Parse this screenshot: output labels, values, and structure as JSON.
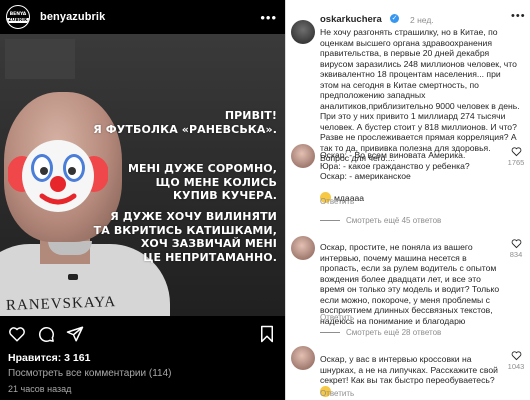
{
  "post": {
    "account": "benyazubrik",
    "avatar_text_top": "BENYA",
    "avatar_text_bottom": "ZUBRIK",
    "more_icon": "ellipsis-icon",
    "image": {
      "text_line1": "ПРИВІТ!",
      "text_line2": "Я ФУТБОЛКА «РАНЕВСЬКА».",
      "text_block2": [
        "МЕНІ ДУЖЕ СОРОМНО,",
        "ЩО МЕНЕ КОЛИСЬ",
        "КУПИВ КУЧЕРА."
      ],
      "text_block3": [
        "Я ДУЖЕ ХОЧУ ВИЛИНЯТИ",
        "ТА ВКРИТИСЬ КАТИШКАМИ,",
        "ХОЧ ЗАЗВИЧАЙ МЕНІ",
        "ЦЕ НЕПРИТАМАННО."
      ],
      "shirt_text": "RANEVSKAYA"
    },
    "actions": [
      "heart-icon",
      "comment-icon",
      "share-icon",
      "save-icon"
    ],
    "likes": "Нравится: 3 161",
    "view_all_comments": "Посмотреть все комментарии (114)",
    "time_ago": "21 часов назад"
  },
  "comments_panel": {
    "author": {
      "name": "oskarkuchera",
      "time": "2 нед.",
      "text": "Не хочу разгонять страшилку, но в Китае, по оценкам высшего органа здравоохранения правительства, в первые 20 дней декабря вирусом заразились 248 миллионов человек, что эквивалентно 18 процентам населения... при этом на сегодня в Китае смертность, по предположению западных аналитиков,приблизительно 9000 человек в день. При это у них привито 1 миллиард 274 тысячи человек. А бустер стоит у 818 миллионов. И что? Разве не прослеживается прямая корреляция? А так то да, прививка полезна для здоровья. Вопрос для чего...."
    },
    "comments": [
      {
        "lines": [
          "Оскар: - Во всем виновата Америка.",
          "Юра: - какое гражданство у ребенка?",
          "Оскар: - американское"
        ],
        "extra": "мдаааа",
        "reply": "Ответить",
        "likes": "1765",
        "show_more": "Смотреть ещё 45 ответов"
      },
      {
        "text": "Оскар, простите, не поняла из вашего интервью, почему машина несется в пропасть, если за рулем водитель с опытом вождения более двадцати лет, и все это время он только эту модель и водит? Только если можно, покороче, у меня проблемы с восприятием длинных бессвязных текстов, надеюсь на понимание и благодарю",
        "reply": "Ответить",
        "likes": "834",
        "show_more": "Смотреть ещё 28 ответов"
      },
      {
        "text": "Оскар, у вас в интервью кроссовки на шнурках, а не на липучках. Расскажите свой секрет! Как вы так быстро переобуваетесь?",
        "reply": "Ответить",
        "likes": "1043"
      }
    ]
  },
  "colors": {
    "left_bg": "#000000",
    "verified": "#3797f0",
    "muted": "#8e8e8e"
  }
}
